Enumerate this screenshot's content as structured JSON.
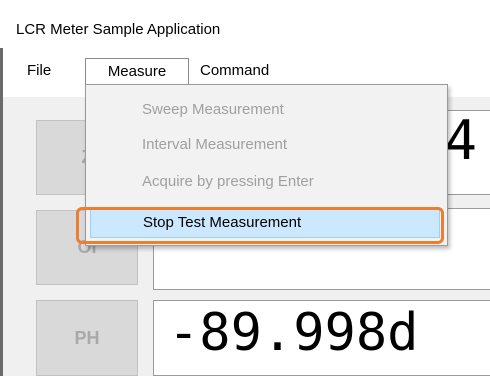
{
  "window": {
    "title": "LCR Meter Sample Application"
  },
  "menubar": {
    "items": [
      {
        "label": "File"
      },
      {
        "label": "Measure"
      },
      {
        "label": "Command"
      }
    ]
  },
  "measure_menu": {
    "items": [
      {
        "label": "Sweep Measurement",
        "enabled": false
      },
      {
        "label": "Interval Measurement",
        "enabled": false
      },
      {
        "label": "Acquire by pressing Enter",
        "enabled": false
      },
      {
        "label": "Stop Test Measurement",
        "enabled": true,
        "highlighted": true
      }
    ]
  },
  "side_buttons": [
    {
      "label": "Z"
    },
    {
      "label": "OI"
    },
    {
      "label": "PH"
    }
  ],
  "displays": {
    "primary": "54",
    "secondary": "",
    "phase": "-89.998d"
  },
  "colors": {
    "highlight_outline": "#ed7d31",
    "selected_item_bg": "#cce8ff",
    "disabled_text": "#a0a0a0"
  }
}
